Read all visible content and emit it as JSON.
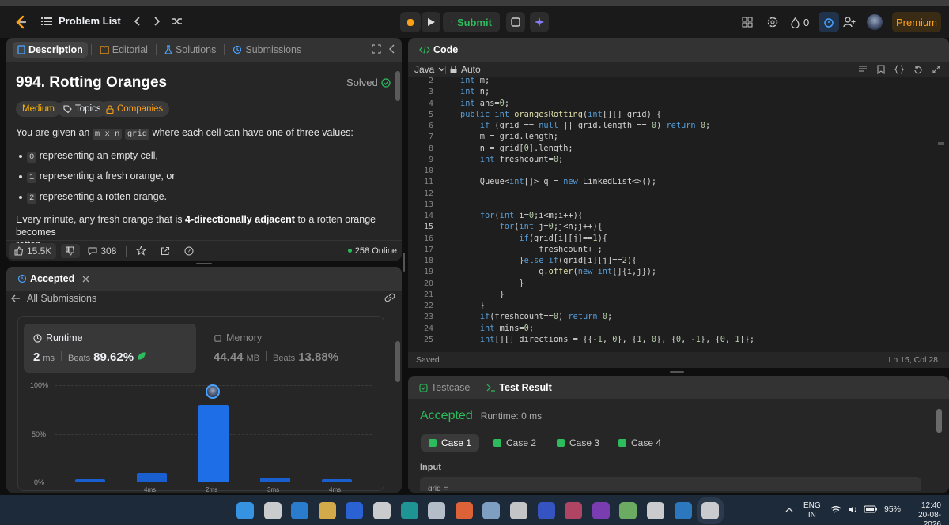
{
  "topbar": {
    "problem_list": "Problem List",
    "submit": "Submit",
    "streak": "0",
    "premium": "Premium"
  },
  "desc_tabs": [
    "Description",
    "Editorial",
    "Solutions",
    "Submissions"
  ],
  "problem": {
    "title": "994. Rotting Oranges",
    "solved": "Solved",
    "difficulty": "Medium",
    "topics": "Topics",
    "companies": "Companies",
    "intro_a": "You are given an",
    "intro_code": "m x n",
    "intro_code2": "grid",
    "intro_b": "where each cell can have one of three values:",
    "bullets": [
      {
        "code": "0",
        "text": "representing an empty cell,"
      },
      {
        "code": "1",
        "text": "representing a fresh orange, or"
      },
      {
        "code": "2",
        "text": "representing a rotten orange."
      }
    ],
    "minute_a": "Every minute, any fresh orange that is",
    "minute_b": "4-directionally adjacent",
    "minute_c": "to a rotten orange becomes",
    "minute_d": "rotten."
  },
  "footer": {
    "likes": "15.5K",
    "comments": "308",
    "online": "258 Online"
  },
  "result": {
    "tab": "Accepted",
    "all_submissions": "All Submissions",
    "runtime_label": "Runtime",
    "runtime_value": "2",
    "runtime_unit": "ms",
    "beats_label": "Beats",
    "runtime_beats": "89.62%",
    "memory_label": "Memory",
    "memory_value": "44.44",
    "memory_unit": "MB",
    "memory_beats": "13.88%"
  },
  "chart_data": {
    "type": "bar",
    "ytick_labels": [
      "100%",
      "50%",
      "0%"
    ],
    "xtick_labels": [
      "4ms",
      "2ms",
      "3ms",
      "4ms"
    ],
    "values": [
      3,
      10,
      80,
      5,
      3
    ],
    "ylim": [
      0,
      100
    ],
    "highlight_index": 2
  },
  "code": {
    "tab": "Code",
    "lang": "Java",
    "auto": "Auto",
    "saved": "Saved",
    "cursor": "Ln 15, Col 28",
    "lines": [
      {
        "n": "2",
        "t": "int m;"
      },
      {
        "n": "3",
        "t": "int n;"
      },
      {
        "n": "4",
        "t": "int ans=0;"
      },
      {
        "n": "5",
        "t": "public int orangesRotting(int[][] grid) {"
      },
      {
        "n": "6",
        "t": "    if (grid == null || grid.length == 0) return 0;"
      },
      {
        "n": "7",
        "t": "    m = grid.length;"
      },
      {
        "n": "8",
        "t": "    n = grid[0].length;"
      },
      {
        "n": "9",
        "t": "    int freshcount=0;"
      },
      {
        "n": "10",
        "t": ""
      },
      {
        "n": "11",
        "t": "    Queue<int[]> q = new LinkedList<>();"
      },
      {
        "n": "12",
        "t": ""
      },
      {
        "n": "13",
        "t": ""
      },
      {
        "n": "14",
        "t": "    for(int i=0;i<m;i++){"
      },
      {
        "n": "15",
        "t": "        for(int j=0;j<n;j++){"
      },
      {
        "n": "16",
        "t": "            if(grid[i][j]==1){"
      },
      {
        "n": "17",
        "t": "                freshcount++;"
      },
      {
        "n": "18",
        "t": "            }else if(grid[i][j]==2){"
      },
      {
        "n": "19",
        "t": "                q.offer(new int[]{i,j});"
      },
      {
        "n": "20",
        "t": "            }"
      },
      {
        "n": "21",
        "t": "        }"
      },
      {
        "n": "22",
        "t": "    }"
      },
      {
        "n": "23",
        "t": "    if(freshcount==0) return 0;"
      },
      {
        "n": "24",
        "t": "    int mins=0;"
      },
      {
        "n": "25",
        "t": "    int[][] directions = {{-1, 0}, {1, 0}, {0, -1}, {0, 1}};"
      }
    ]
  },
  "testpanel": {
    "testcase": "Testcase",
    "test_result": "Test Result",
    "status": "Accepted",
    "runtime": "Runtime: 0 ms",
    "cases": [
      "Case 1",
      "Case 2",
      "Case 3",
      "Case 4"
    ],
    "input_label": "Input",
    "input_preview": "grid ="
  },
  "taskbar": {
    "lang1": "ENG",
    "lang2": "IN",
    "battery": "95%",
    "time": "12:40",
    "date": "20-08-2026"
  }
}
